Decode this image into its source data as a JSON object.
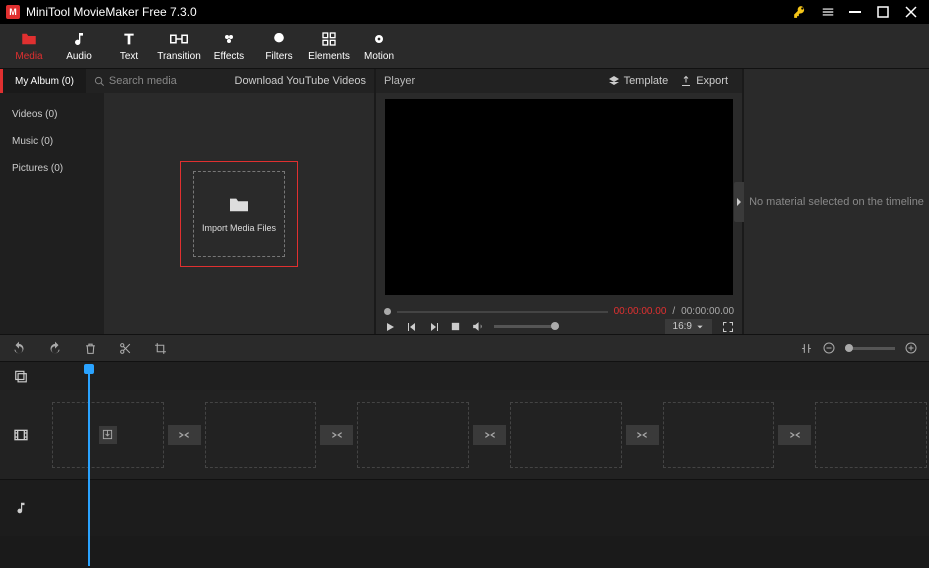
{
  "titlebar": {
    "app_name": "MiniTool MovieMaker Free 7.3.0"
  },
  "tabs": {
    "media": "Media",
    "audio": "Audio",
    "text": "Text",
    "transition": "Transition",
    "effects": "Effects",
    "filters": "Filters",
    "elements": "Elements",
    "motion": "Motion"
  },
  "media": {
    "album_tab": "My Album (0)",
    "search_placeholder": "Search media",
    "download_yt": "Download YouTube Videos",
    "side_items": [
      "Videos (0)",
      "Music (0)",
      "Pictures (0)"
    ],
    "import_label": "Import Media Files"
  },
  "player": {
    "title": "Player",
    "template_btn": "Template",
    "export_btn": "Export",
    "time_current": "00:00:00.00",
    "time_sep": "/",
    "time_duration": "00:00:00.00",
    "aspect": "16:9"
  },
  "inspector": {
    "empty_msg": "No material selected on the timeline"
  }
}
